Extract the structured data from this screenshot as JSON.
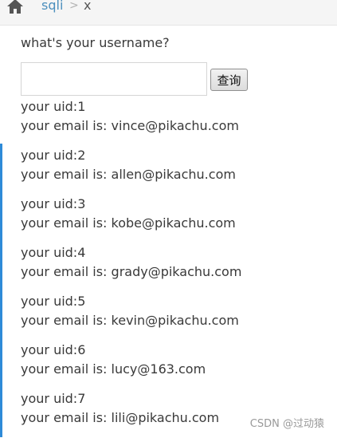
{
  "breadcrumb": {
    "home_label": "sqli",
    "separator": ">",
    "current": "x"
  },
  "form": {
    "question": "what's your username?",
    "input_value": "",
    "button_label": "查询"
  },
  "results": [
    {
      "uid": "your uid:1",
      "email": "your email is: vince@pikachu.com"
    },
    {
      "uid": "your uid:2",
      "email": "your email is: allen@pikachu.com"
    },
    {
      "uid": "your uid:3",
      "email": "your email is: kobe@pikachu.com"
    },
    {
      "uid": "your uid:4",
      "email": "your email is: grady@pikachu.com"
    },
    {
      "uid": "your uid:5",
      "email": "your email is: kevin@pikachu.com"
    },
    {
      "uid": "your uid:6",
      "email": "your email is: lucy@163.com"
    },
    {
      "uid": "your uid:7",
      "email": "your email is: lili@pikachu.com"
    }
  ],
  "watermark": "CSDN @过动猿",
  "colors": {
    "accent": "#2e8bd8",
    "link": "#4c8fbd",
    "breadcrumb_bg": "#f5f5f5"
  }
}
